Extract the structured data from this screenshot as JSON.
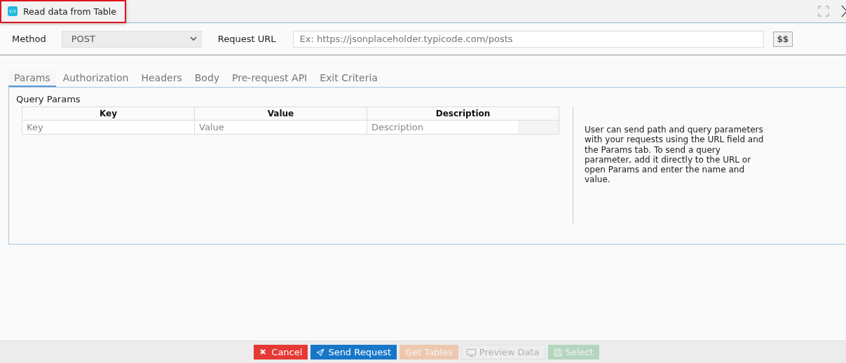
{
  "title_field": {
    "value": "Read data from Table"
  },
  "request": {
    "method_label": "Method",
    "method": "POST",
    "url_label": "Request URL",
    "url_placeholder": "Ex: https://jsonplaceholder.typicode.com/posts",
    "vars_button": "$$"
  },
  "tabs": [
    {
      "label": "Params",
      "selected": true
    },
    {
      "label": "Authorization",
      "selected": false
    },
    {
      "label": "Headers",
      "selected": false
    },
    {
      "label": "Body",
      "selected": false
    },
    {
      "label": "Pre-request API",
      "selected": false
    },
    {
      "label": "Exit Criteria",
      "selected": false
    }
  ],
  "params": {
    "title": "Query Params",
    "columns": [
      "Key",
      "Value",
      "Description"
    ],
    "row_placeholders": [
      "Key",
      "Value",
      "Description"
    ],
    "help": "User can send path and query parameters with your requests using the URL field and the Params tab. To send a query parameter, add it directly to the URL or open Params and enter the name and value."
  },
  "buttons": [
    {
      "label": "Cancel",
      "kind": "cancel",
      "disabled": false
    },
    {
      "label": "Send Request",
      "kind": "send",
      "disabled": false
    },
    {
      "label": "Get Tables",
      "kind": "tables",
      "disabled": true
    },
    {
      "label": "Preview Data",
      "kind": "preview",
      "disabled": true
    },
    {
      "label": "Select",
      "kind": "select",
      "disabled": true
    }
  ]
}
